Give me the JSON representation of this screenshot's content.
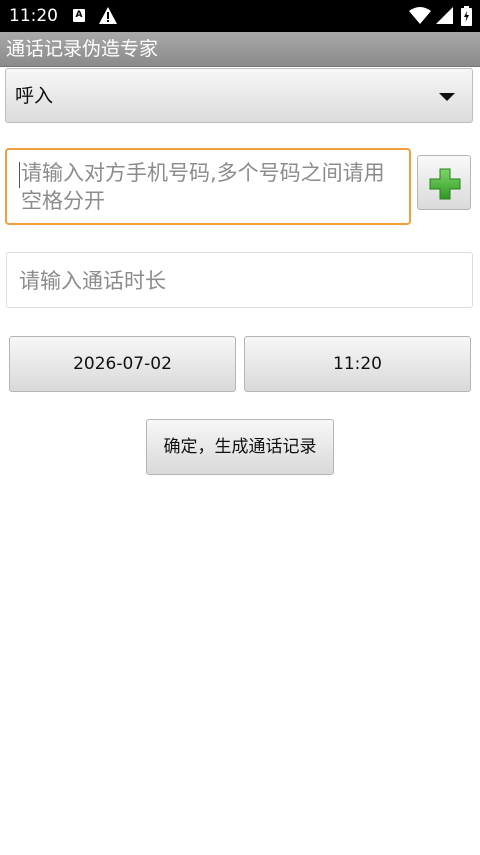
{
  "status_bar": {
    "time": "11:20",
    "notification_icons": [
      "a-icon",
      "warning-icon"
    ],
    "system_icons": [
      "wifi-icon",
      "signal-icon",
      "battery-icon"
    ]
  },
  "app": {
    "title": "通话记录伪造专家"
  },
  "form": {
    "call_type": {
      "selected": "呼入"
    },
    "phone_input": {
      "value": "",
      "placeholder": "请输入对方手机号码,多个号码之间请用空格分开"
    },
    "add_button": {
      "icon": "green-plus-icon"
    },
    "duration_input": {
      "value": "",
      "placeholder": "请输入通话时长"
    },
    "date_button": {
      "label": "2026-07-02"
    },
    "time_button": {
      "label": "11:20"
    },
    "confirm_button": {
      "label": "确定，生成通话记录"
    }
  },
  "colors": {
    "focus_border": "#f0a03a",
    "title_bar": "#9a9a9a",
    "plus_green": "#3aa52b"
  }
}
